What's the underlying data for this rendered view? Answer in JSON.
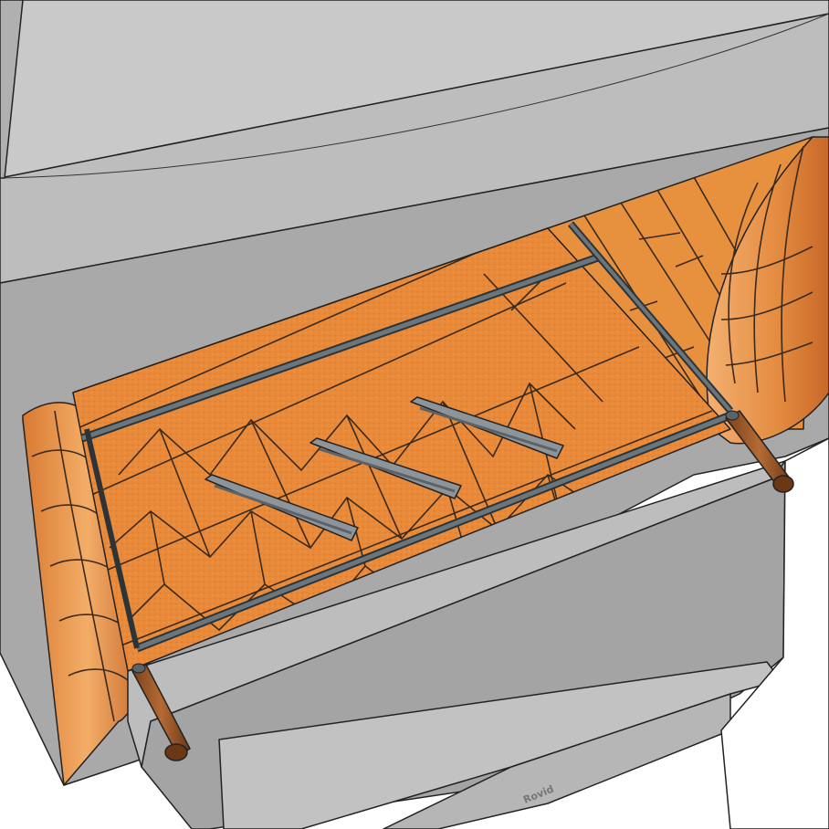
{
  "scene": {
    "colors": {
      "background": "#ffffff",
      "steel_top": "#c9c9c9",
      "steel_front": "#a9a9a9",
      "steel_dark": "#8c8c8c",
      "brick": "#e98a3a",
      "brick_light": "#f3a95d",
      "brick_dark": "#c8692a",
      "rod": "#5f6b73",
      "handle": "#9a5a2c",
      "slot": "#8d959b"
    },
    "parts": {
      "firebox_floor": "herringbone-firebrick-floor",
      "grate_slots": 3,
      "grate_rods": 2,
      "handles": 2
    },
    "engraving": "Rovid"
  }
}
